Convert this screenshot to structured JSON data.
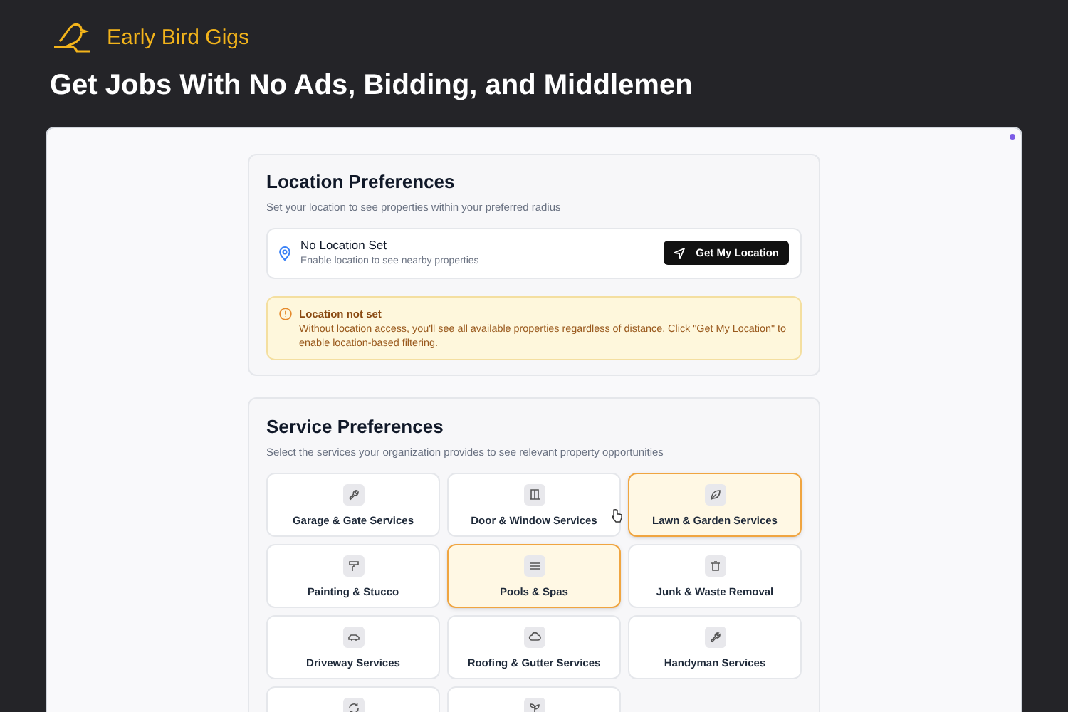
{
  "brand": {
    "name": "Early Bird Gigs"
  },
  "headline": "Get Jobs With No Ads, Bidding, and Middlemen",
  "location": {
    "title": "Location Preferences",
    "subtitle": "Set your location to see properties within your preferred radius",
    "status_title": "No Location Set",
    "status_text": "Enable location to see nearby properties",
    "button": "Get My Location",
    "alert": {
      "title": "Location not set",
      "text": "Without location access, you'll see all available properties regardless of distance. Click \"Get My Location\" to enable location-based filtering."
    }
  },
  "services": {
    "title": "Service Preferences",
    "subtitle": "Select the services your organization provides to see relevant property opportunities",
    "items": [
      {
        "label": "Garage & Gate Services",
        "selected": false
      },
      {
        "label": "Door & Window Services",
        "selected": false
      },
      {
        "label": "Lawn & Garden Services",
        "selected": true
      },
      {
        "label": "Painting & Stucco",
        "selected": false
      },
      {
        "label": "Pools & Spas",
        "selected": true
      },
      {
        "label": "Junk & Waste Removal",
        "selected": false
      },
      {
        "label": "Driveway Services",
        "selected": false
      },
      {
        "label": "Roofing & Gutter Services",
        "selected": false
      },
      {
        "label": "Handyman Services",
        "selected": false
      },
      {
        "selected": false
      },
      {
        "selected": false
      }
    ]
  }
}
